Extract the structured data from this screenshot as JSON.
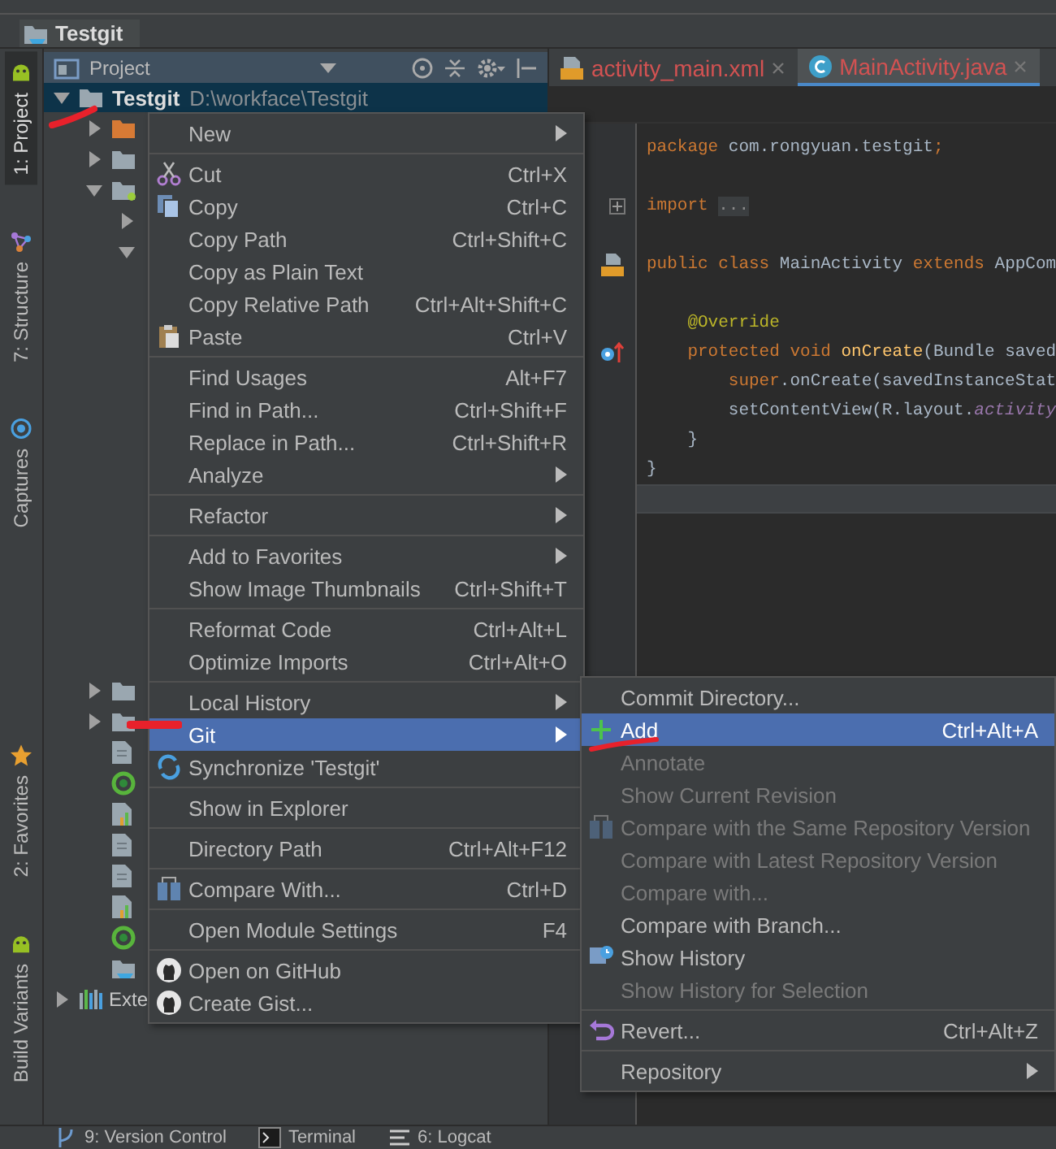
{
  "breadcrumb": {
    "label": "Testgit"
  },
  "tool_strip": {
    "top": [
      {
        "label": "1: Project",
        "selected": true
      },
      {
        "label": "7: Structure",
        "selected": false
      },
      {
        "label": "Captures",
        "selected": false
      }
    ],
    "bottom": [
      {
        "label": "2: Favorites",
        "selected": false
      },
      {
        "label": "Build Variants",
        "selected": false
      }
    ]
  },
  "project_panel": {
    "title": "Project",
    "nodes": [
      {
        "label": "Testgit",
        "path": "D:\\workface\\Testgit",
        "kind": "folder",
        "expanded": true,
        "selected": true,
        "children": [
          {
            "kind": "folder-orange",
            "expanded": false
          },
          {
            "kind": "folder",
            "expanded": false
          },
          {
            "kind": "folder-module",
            "expanded": true,
            "children": [
              {
                "expanded": false
              },
              {
                "expanded": true
              }
            ]
          },
          {
            "kind": "folder",
            "expanded": false
          },
          {
            "kind": "folder",
            "expanded": false
          },
          {
            "kind": "file"
          },
          {
            "kind": "gradle"
          },
          {
            "kind": "chart-file"
          },
          {
            "kind": "file"
          },
          {
            "kind": "file"
          },
          {
            "kind": "chart-file"
          },
          {
            "kind": "gradle"
          },
          {
            "kind": "folder-blue"
          }
        ]
      },
      {
        "label": "Exte",
        "kind": "libraries",
        "expanded": false,
        "selected": false
      }
    ]
  },
  "editor": {
    "tabs": [
      {
        "label": "activity_main.xml",
        "kind": "xml",
        "selected": false
      },
      {
        "label": "MainActivity.java",
        "kind": "class",
        "selected": true
      }
    ],
    "lines": [
      {
        "kind": "code",
        "current": false,
        "tokens": [
          {
            "text": "package ",
            "kind": "keyword"
          },
          {
            "text": "com.rongyuan.testgit",
            "kind": "plain"
          },
          {
            "text": ";",
            "kind": "keyword"
          }
        ]
      },
      {
        "kind": "blank",
        "current": false
      },
      {
        "kind": "code",
        "current": false,
        "tokens": [
          {
            "text": "import ",
            "kind": "keyword"
          },
          {
            "text": "...",
            "kind": "folded"
          }
        ]
      },
      {
        "kind": "blank",
        "current": false
      },
      {
        "kind": "code",
        "current": false,
        "tokens": [
          {
            "text": "public class ",
            "kind": "keyword"
          },
          {
            "text": "MainActivity ",
            "kind": "plain"
          },
          {
            "text": "extends ",
            "kind": "keyword"
          },
          {
            "text": "AppCom",
            "kind": "plain"
          }
        ]
      },
      {
        "kind": "blank",
        "current": false
      },
      {
        "kind": "code",
        "current": false,
        "tokens": [
          {
            "text": "    @Override",
            "kind": "annotation"
          }
        ]
      },
      {
        "kind": "code",
        "current": false,
        "tokens": [
          {
            "text": "    protected void ",
            "kind": "keyword"
          },
          {
            "text": "onCreate",
            "kind": "method"
          },
          {
            "text": "(Bundle saved",
            "kind": "plain"
          }
        ]
      },
      {
        "kind": "code",
        "current": false,
        "tokens": [
          {
            "text": "        super",
            "kind": "keyword"
          },
          {
            "text": ".onCreate(savedInstanceStat",
            "kind": "plain"
          }
        ]
      },
      {
        "kind": "code",
        "current": false,
        "tokens": [
          {
            "text": "        setContentView(R.layout.",
            "kind": "plain"
          },
          {
            "text": "activity",
            "kind": "field"
          }
        ]
      },
      {
        "kind": "code",
        "current": false,
        "tokens": [
          {
            "text": "    }",
            "kind": "plain"
          }
        ]
      },
      {
        "kind": "code",
        "current": false,
        "tokens": [
          {
            "text": "}",
            "kind": "plain"
          }
        ]
      },
      {
        "kind": "blank",
        "current": true
      }
    ]
  },
  "context_menu": {
    "groups": [
      [
        {
          "label": "New",
          "submenu": true,
          "selected": false
        }
      ],
      [
        {
          "label": "Cut",
          "shortcut": "Ctrl+X",
          "kind": "scissors",
          "submenu": false,
          "selected": false
        },
        {
          "label": "Copy",
          "shortcut": "Ctrl+C",
          "kind": "copy",
          "submenu": false,
          "selected": false
        },
        {
          "label": "Copy Path",
          "shortcut": "Ctrl+Shift+C",
          "submenu": false,
          "selected": false
        },
        {
          "label": "Copy as Plain Text",
          "submenu": false,
          "selected": false
        },
        {
          "label": "Copy Relative Path",
          "shortcut": "Ctrl+Alt+Shift+C",
          "submenu": false,
          "selected": false
        },
        {
          "label": "Paste",
          "shortcut": "Ctrl+V",
          "kind": "paste",
          "submenu": false,
          "selected": false
        }
      ],
      [
        {
          "label": "Find Usages",
          "shortcut": "Alt+F7",
          "submenu": false,
          "selected": false
        },
        {
          "label": "Find in Path...",
          "shortcut": "Ctrl+Shift+F",
          "submenu": false,
          "selected": false
        },
        {
          "label": "Replace in Path...",
          "shortcut": "Ctrl+Shift+R",
          "submenu": false,
          "selected": false
        },
        {
          "label": "Analyze",
          "submenu": true,
          "selected": false
        }
      ],
      [
        {
          "label": "Refactor",
          "submenu": true,
          "selected": false
        }
      ],
      [
        {
          "label": "Add to Favorites",
          "submenu": true,
          "selected": false
        },
        {
          "label": "Show Image Thumbnails",
          "shortcut": "Ctrl+Shift+T",
          "submenu": false,
          "selected": false
        }
      ],
      [
        {
          "label": "Reformat Code",
          "shortcut": "Ctrl+Alt+L",
          "submenu": false,
          "selected": false
        },
        {
          "label": "Optimize Imports",
          "shortcut": "Ctrl+Alt+O",
          "submenu": false,
          "selected": false
        }
      ],
      [
        {
          "label": "Local History",
          "submenu": true,
          "selected": false
        },
        {
          "label": "Git",
          "submenu": true,
          "selected": true
        },
        {
          "label": "Synchronize 'Testgit'",
          "kind": "sync",
          "submenu": false,
          "selected": false
        }
      ],
      [
        {
          "label": "Show in Explorer",
          "submenu": false,
          "selected": false
        }
      ],
      [
        {
          "label": "Directory Path",
          "shortcut": "Ctrl+Alt+F12",
          "submenu": false,
          "selected": false
        }
      ],
      [
        {
          "label": "Compare With...",
          "shortcut": "Ctrl+D",
          "kind": "compare",
          "submenu": false,
          "selected": false
        }
      ],
      [
        {
          "label": "Open Module Settings",
          "shortcut": "F4",
          "submenu": false,
          "selected": false
        }
      ],
      [
        {
          "label": "Open on GitHub",
          "kind": "github",
          "submenu": false,
          "selected": false
        },
        {
          "label": "Create Gist...",
          "kind": "github",
          "submenu": false,
          "selected": false
        }
      ]
    ]
  },
  "git_submenu": {
    "groups": [
      [
        {
          "label": "Commit Directory...",
          "submenu": false,
          "selected": false,
          "disabled": false
        },
        {
          "label": "Add",
          "shortcut": "Ctrl+Alt+A",
          "kind": "plus",
          "submenu": false,
          "selected": true,
          "disabled": false
        },
        {
          "label": "Annotate",
          "submenu": false,
          "selected": false,
          "disabled": true
        },
        {
          "label": "Show Current Revision",
          "submenu": false,
          "selected": false,
          "disabled": true
        },
        {
          "label": "Compare with the Same Repository Version",
          "kind": "compare",
          "submenu": false,
          "selected": false,
          "disabled": true
        },
        {
          "label": "Compare with Latest Repository Version",
          "submenu": false,
          "selected": false,
          "disabled": true
        },
        {
          "label": "Compare with...",
          "submenu": false,
          "selected": false,
          "disabled": true
        },
        {
          "label": "Compare with Branch...",
          "submenu": false,
          "selected": false,
          "disabled": false
        },
        {
          "label": "Show History",
          "kind": "history",
          "submenu": false,
          "selected": false,
          "disabled": false
        },
        {
          "label": "Show History for Selection",
          "submenu": false,
          "selected": false,
          "disabled": true
        }
      ],
      [
        {
          "label": "Revert...",
          "shortcut": "Ctrl+Alt+Z",
          "kind": "revert",
          "submenu": false,
          "selected": false,
          "disabled": false
        }
      ],
      [
        {
          "label": "Repository",
          "submenu": true,
          "selected": false,
          "disabled": false
        }
      ]
    ]
  },
  "bottom_bar": [
    {
      "label": "9: Version Control",
      "kind": "branch"
    },
    {
      "label": "Terminal",
      "kind": "terminal"
    },
    {
      "label": "6: Logcat",
      "kind": "logcat"
    }
  ]
}
